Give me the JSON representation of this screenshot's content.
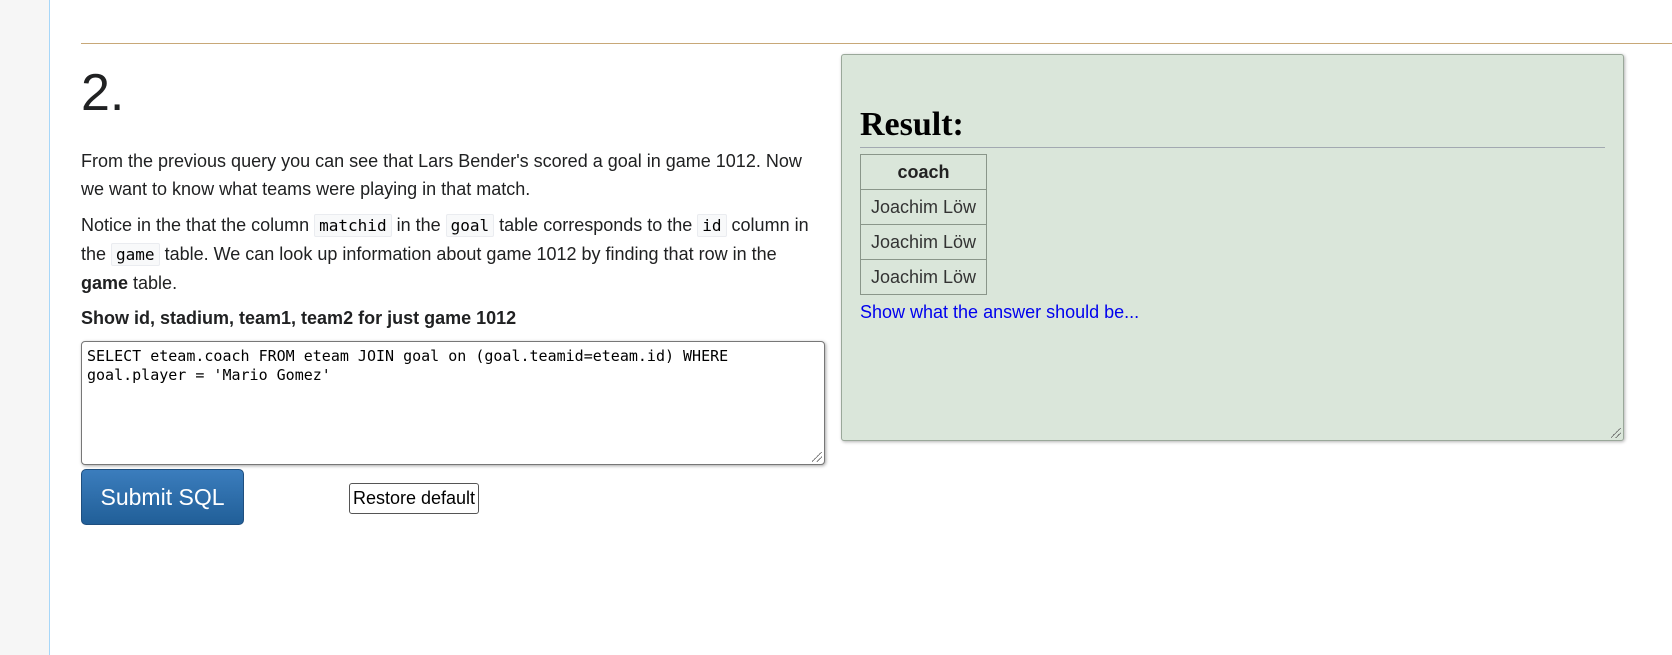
{
  "question": {
    "number": "2.",
    "para1": "From the previous query you can see that Lars Bender's scored a goal in game 1012. Now we want to know what teams were playing in that match.",
    "para2": {
      "t1": "Notice in the that the column ",
      "code1": "matchid",
      "t2": " in the ",
      "code2": "goal",
      "t3": " table corresponds to the ",
      "code3": "id",
      "t4": " column in the ",
      "code4": "game",
      "t5": " table. We can look up information about game 1012 by finding that row in the ",
      "bold": "game",
      "t6": " table."
    },
    "task": "Show id, stadium, team1, team2 for just game 1012"
  },
  "editor": {
    "sql": "SELECT eteam.coach FROM eteam JOIN goal on (goal.teamid=eteam.id) WHERE goal.player = 'Mario Gomez'"
  },
  "buttons": {
    "submit_label": "Submit SQL",
    "restore_label": "Restore default"
  },
  "result": {
    "title": "Result:",
    "columns": [
      "coach"
    ],
    "rows": [
      [
        "Joachim Löw"
      ],
      [
        "Joachim Löw"
      ],
      [
        "Joachim Löw"
      ]
    ],
    "answer_link": "Show what the answer should be..."
  },
  "colors": {
    "result_bg": "#dae6da",
    "button_blue": "#2b6cab",
    "link": "#0000ee",
    "rule": "#c8a878"
  }
}
